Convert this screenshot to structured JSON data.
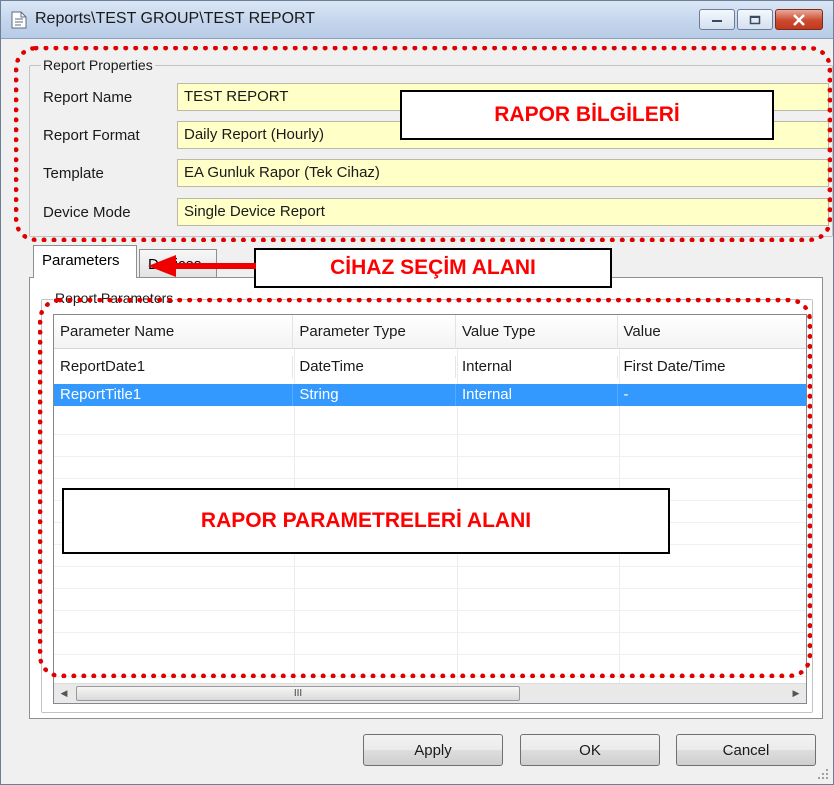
{
  "window": {
    "title": "Reports\\TEST GROUP\\TEST REPORT"
  },
  "properties": {
    "legend": "Report Properties",
    "fields": [
      {
        "label": "Report Name",
        "value": "TEST REPORT"
      },
      {
        "label": "Report Format",
        "value": "Daily Report (Hourly)"
      },
      {
        "label": "Template",
        "value": "EA Gunluk Rapor (Tek Cihaz)"
      },
      {
        "label": "Device Mode",
        "value": "Single Device Report"
      }
    ]
  },
  "tabs": [
    {
      "label": "Parameters",
      "active": true
    },
    {
      "label": "Devices",
      "active": false
    }
  ],
  "parameters": {
    "legend": "Report Parameters",
    "columns": [
      "Parameter Name",
      "Parameter Type",
      "Value Type",
      "Value"
    ],
    "rows": [
      {
        "name": "ReportDate1",
        "type": "DateTime",
        "value_type": "Internal",
        "value": "First Date/Time",
        "selected": false
      },
      {
        "name": "ReportTitle1",
        "type": "String",
        "value_type": "Internal",
        "value": "-",
        "selected": true
      }
    ],
    "scroll_thumb": "III"
  },
  "buttons": {
    "apply": "Apply",
    "ok": "OK",
    "cancel": "Cancel"
  },
  "annotations": {
    "rapor_bilgileri": "RAPOR BİLGİLERİ",
    "cihaz_secim": "CİHAZ SEÇİM ALANI",
    "rapor_parametreleri": "RAPOR PARAMETRELERİ ALANI"
  },
  "colors": {
    "annotation_red": "#e00000",
    "selection_blue": "#3399ff",
    "field_yellow": "#ffffc8"
  }
}
